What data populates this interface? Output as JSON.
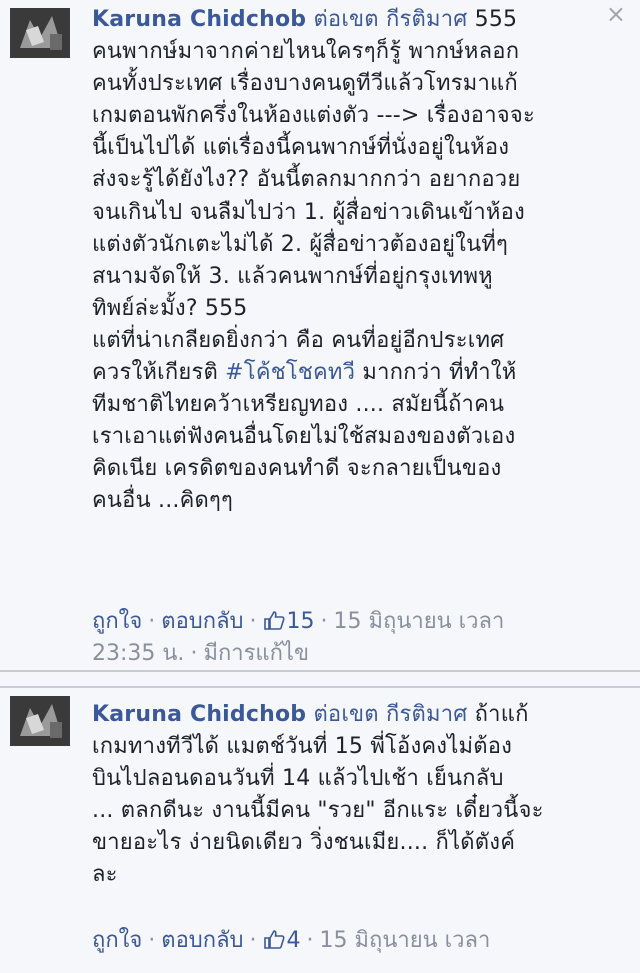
{
  "comment1": {
    "author": "Karuna Chidchob",
    "tags": [
      "ต่อเขต",
      "กีรติมาศ"
    ],
    "after_tags": " 555",
    "lines": [
      "คนพากษ์มาจากค่ายไหนใครๆก็รู้ พากษ์หลอก",
      "คนทั้งประเทศ เรื่องบางคนดูทีวีแล้วโทรมาแก้",
      "เกมตอนพักครึ่งในห้องแต่งตัว ---> เรื่องอาจจะ",
      "นี้เป็นไปได้ แต่เรื่องนี้คนพากษ์ที่นั่งอยู่ในห้อง",
      "ส่งจะรู้ได้ยังไง?? อันนี้ตลกมากกว่า อยากอวย",
      "จนเกินไป จนลืมไปว่า 1. ผู้สื่อข่าวเดินเข้าห้อง",
      "แต่งตัวนักเตะไม่ได้ 2. ผู้สื่อข่าวต้องอยู่ในที่ๆ",
      "สนามจัดให้ 3. แล้วคนพากษ์ที่อยู่กรุงเทพหู",
      "ทิพย์ล่ะมั้ง? 555",
      "แต่ที่น่าเกลียดยิ่งกว่า คือ คนที่อยู่อีกประเทศ"
    ],
    "line11_before": "ควรให้เกียรติ ",
    "hashtag": "#โค้ชโชคทวี",
    "line11_after": " มากกว่า ที่ทำให้",
    "lines_tail": [
      "ทีมชาติไทยคว้าเหรียญทอง .... สมัยนี้ถ้าคน",
      "เราเอาแต่ฟังคนอื่นโดยไม่ใช้สมองของตัวเอง",
      "คิดเนีย เครดิตของคนทำดี จะกลายเป็นของ",
      "คนอื่น ...คิดๆๆ"
    ],
    "like_label": "ถูกใจ",
    "reply_label": "ตอบกลับ",
    "like_count": "15",
    "date": "15 มิถุนายน เวลา",
    "time": "23:35 น.",
    "edited": "มีการแก้ไข",
    "close_glyph": "×"
  },
  "comment2": {
    "author": "Karuna Chidchob",
    "tags": [
      "ต่อเขต",
      "กีรติมาศ"
    ],
    "after_tags": " ถ้าแก้",
    "lines": [
      "เกมทางทีวีได้ แมตช์วันที่ 15 พี่โอ้งคงไม่ต้อง",
      "บินไปลอนดอนวันที่ 14 แล้วไปเช้า เย็นกลับ",
      "... ตลกดีนะ งานนี้มีคน \"รวย\" อีกแระ เดี๋ยวนี้จะ",
      "ขายอะไร ง่ายนิดเดียว วิ่งชนเมีย.... ก็ได้ตังค์",
      "ละ"
    ],
    "like_label": "ถูกใจ",
    "reply_label": "ตอบกลับ",
    "like_count": "4",
    "date": "15 มิถุนายน เวลา"
  },
  "colors": {
    "link": "#3b5998",
    "meta": "#898f9c",
    "text": "#1d2129"
  }
}
